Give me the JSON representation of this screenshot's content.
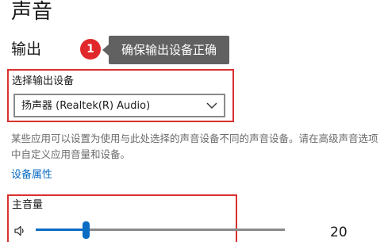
{
  "page": {
    "title": "声音",
    "output_heading": "输出"
  },
  "annotation": {
    "badge_number": "1",
    "tooltip_text": "确保输出设备正确"
  },
  "output": {
    "select_label": "选择输出设备",
    "selected_device": "扬声器 (Realtek(R) Audio)",
    "description": "某些应用可以设置为使用与此处选择的声音设备不同的声音设备。请在高级声音选项中自定义应用音量和设备。",
    "device_properties_link": "设备属性"
  },
  "volume": {
    "label": "主音量",
    "value": "20",
    "level_fraction": 0.2
  },
  "colors": {
    "accent": "#0a6cc2",
    "highlight_border": "#d9312f",
    "badge": "#e0282a",
    "tooltip_bg": "#616161"
  }
}
